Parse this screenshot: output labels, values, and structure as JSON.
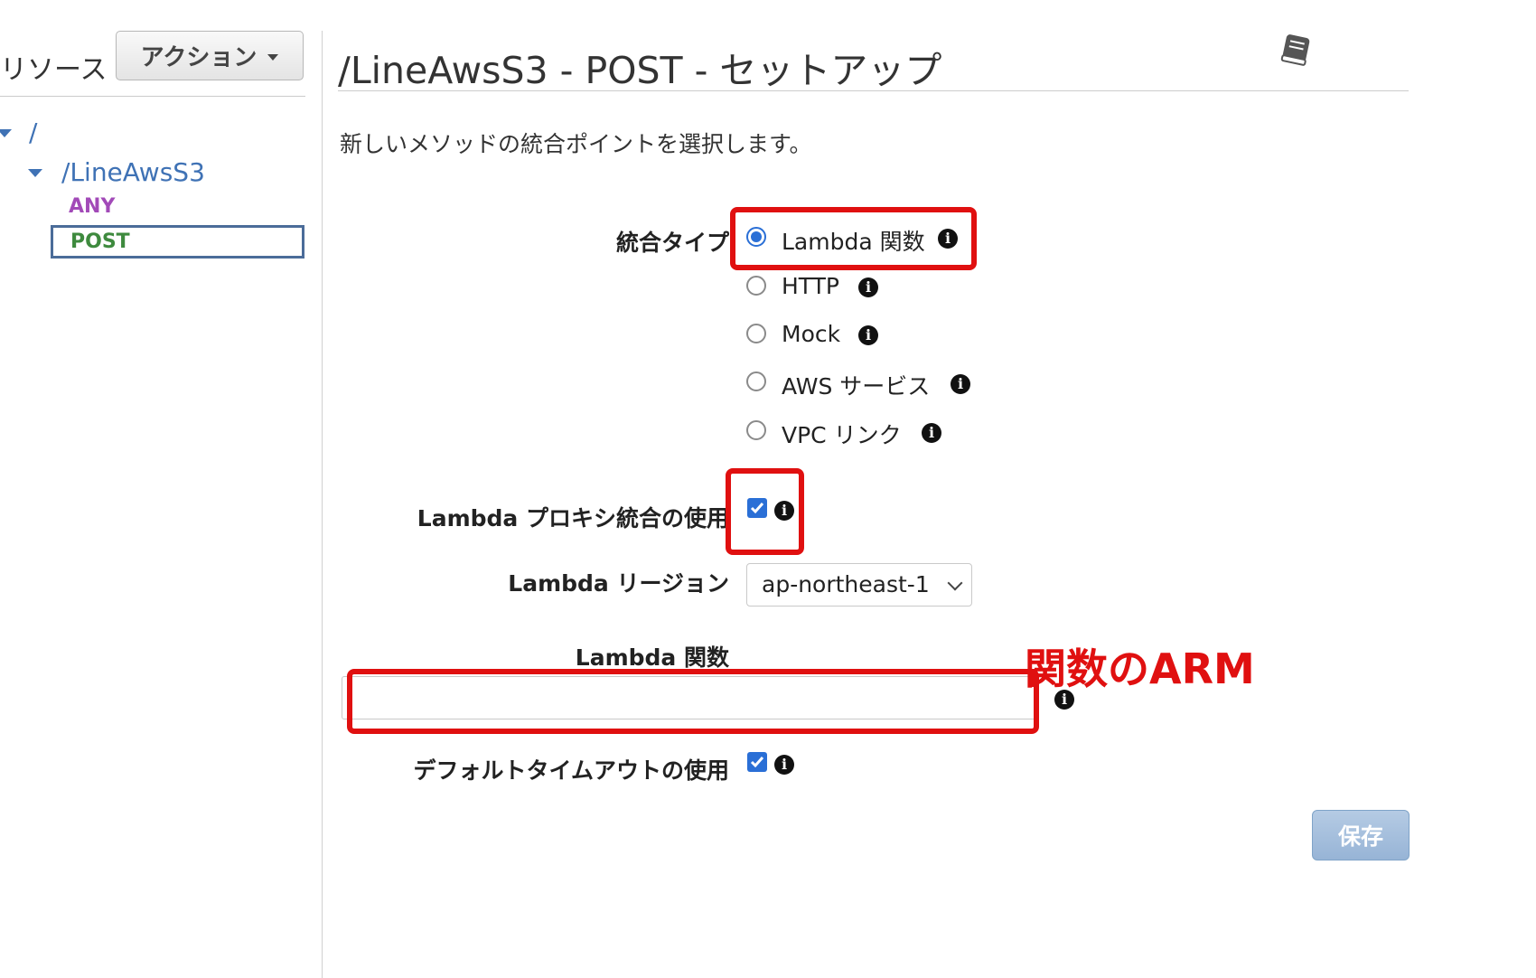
{
  "sidebar": {
    "title": "リソース",
    "actions_label": "アクション",
    "tree": {
      "root": "/",
      "resource": "/LineAwsS3"
    },
    "methods": [
      "ANY",
      "POST"
    ]
  },
  "main": {
    "title": "/LineAwsS3 - POST - セットアップ",
    "description": "新しいメソッドの統合ポイントを選択します。",
    "integration_type": {
      "label": "統合タイプ",
      "options": [
        "Lambda 関数",
        "HTTP",
        "Mock",
        "AWS サービス",
        "VPC リンク"
      ],
      "selected": "Lambda 関数"
    },
    "proxy": {
      "label": "Lambda プロキシ統合の使用",
      "checked": true
    },
    "region": {
      "label": "Lambda リージョン",
      "value": "ap-northeast-1"
    },
    "function": {
      "label": "Lambda 関数",
      "value": ""
    },
    "timeout": {
      "label": "デフォルトタイムアウトの使用",
      "checked": true
    },
    "save_label": "保存"
  },
  "annotation": {
    "text": "関数のARM",
    "color": "#e01010"
  },
  "colors": {
    "link": "#3f72b5",
    "any": "#a24ab8",
    "post": "#3e8a3e",
    "radio": "#2a6fd6"
  },
  "icons": [
    "caret-down-icon",
    "book-icon",
    "info-icon",
    "check-icon",
    "chevron-down-icon"
  ]
}
